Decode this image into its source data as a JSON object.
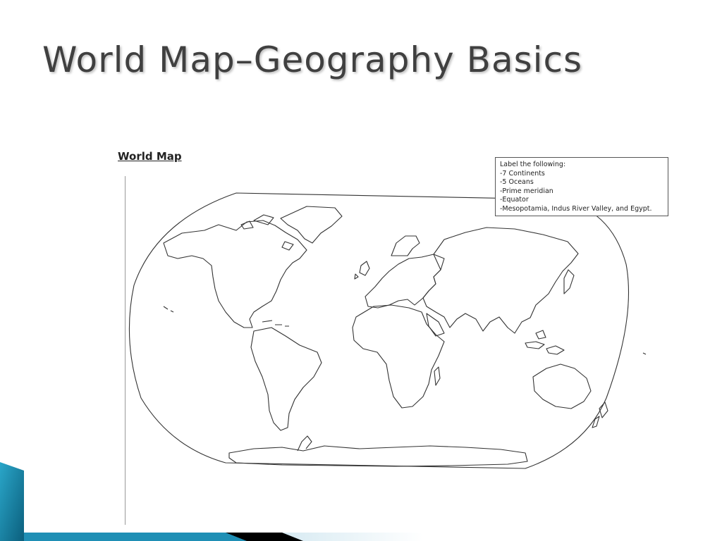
{
  "slide": {
    "title": "World Map–Geography Basics"
  },
  "worksheet": {
    "heading": "World Map",
    "instructions": {
      "heading": "Label the following:",
      "items": [
        "-7 Continents",
        "-5 Oceans",
        "-Prime meridian",
        "-Equator",
        "-Mesopotamia, Indus River Valley, and Egypt."
      ]
    }
  },
  "colors": {
    "title_text": "#404040",
    "map_outline": "#333333",
    "decor_blue": "#1f8fb5",
    "decor_black": "#000000"
  }
}
